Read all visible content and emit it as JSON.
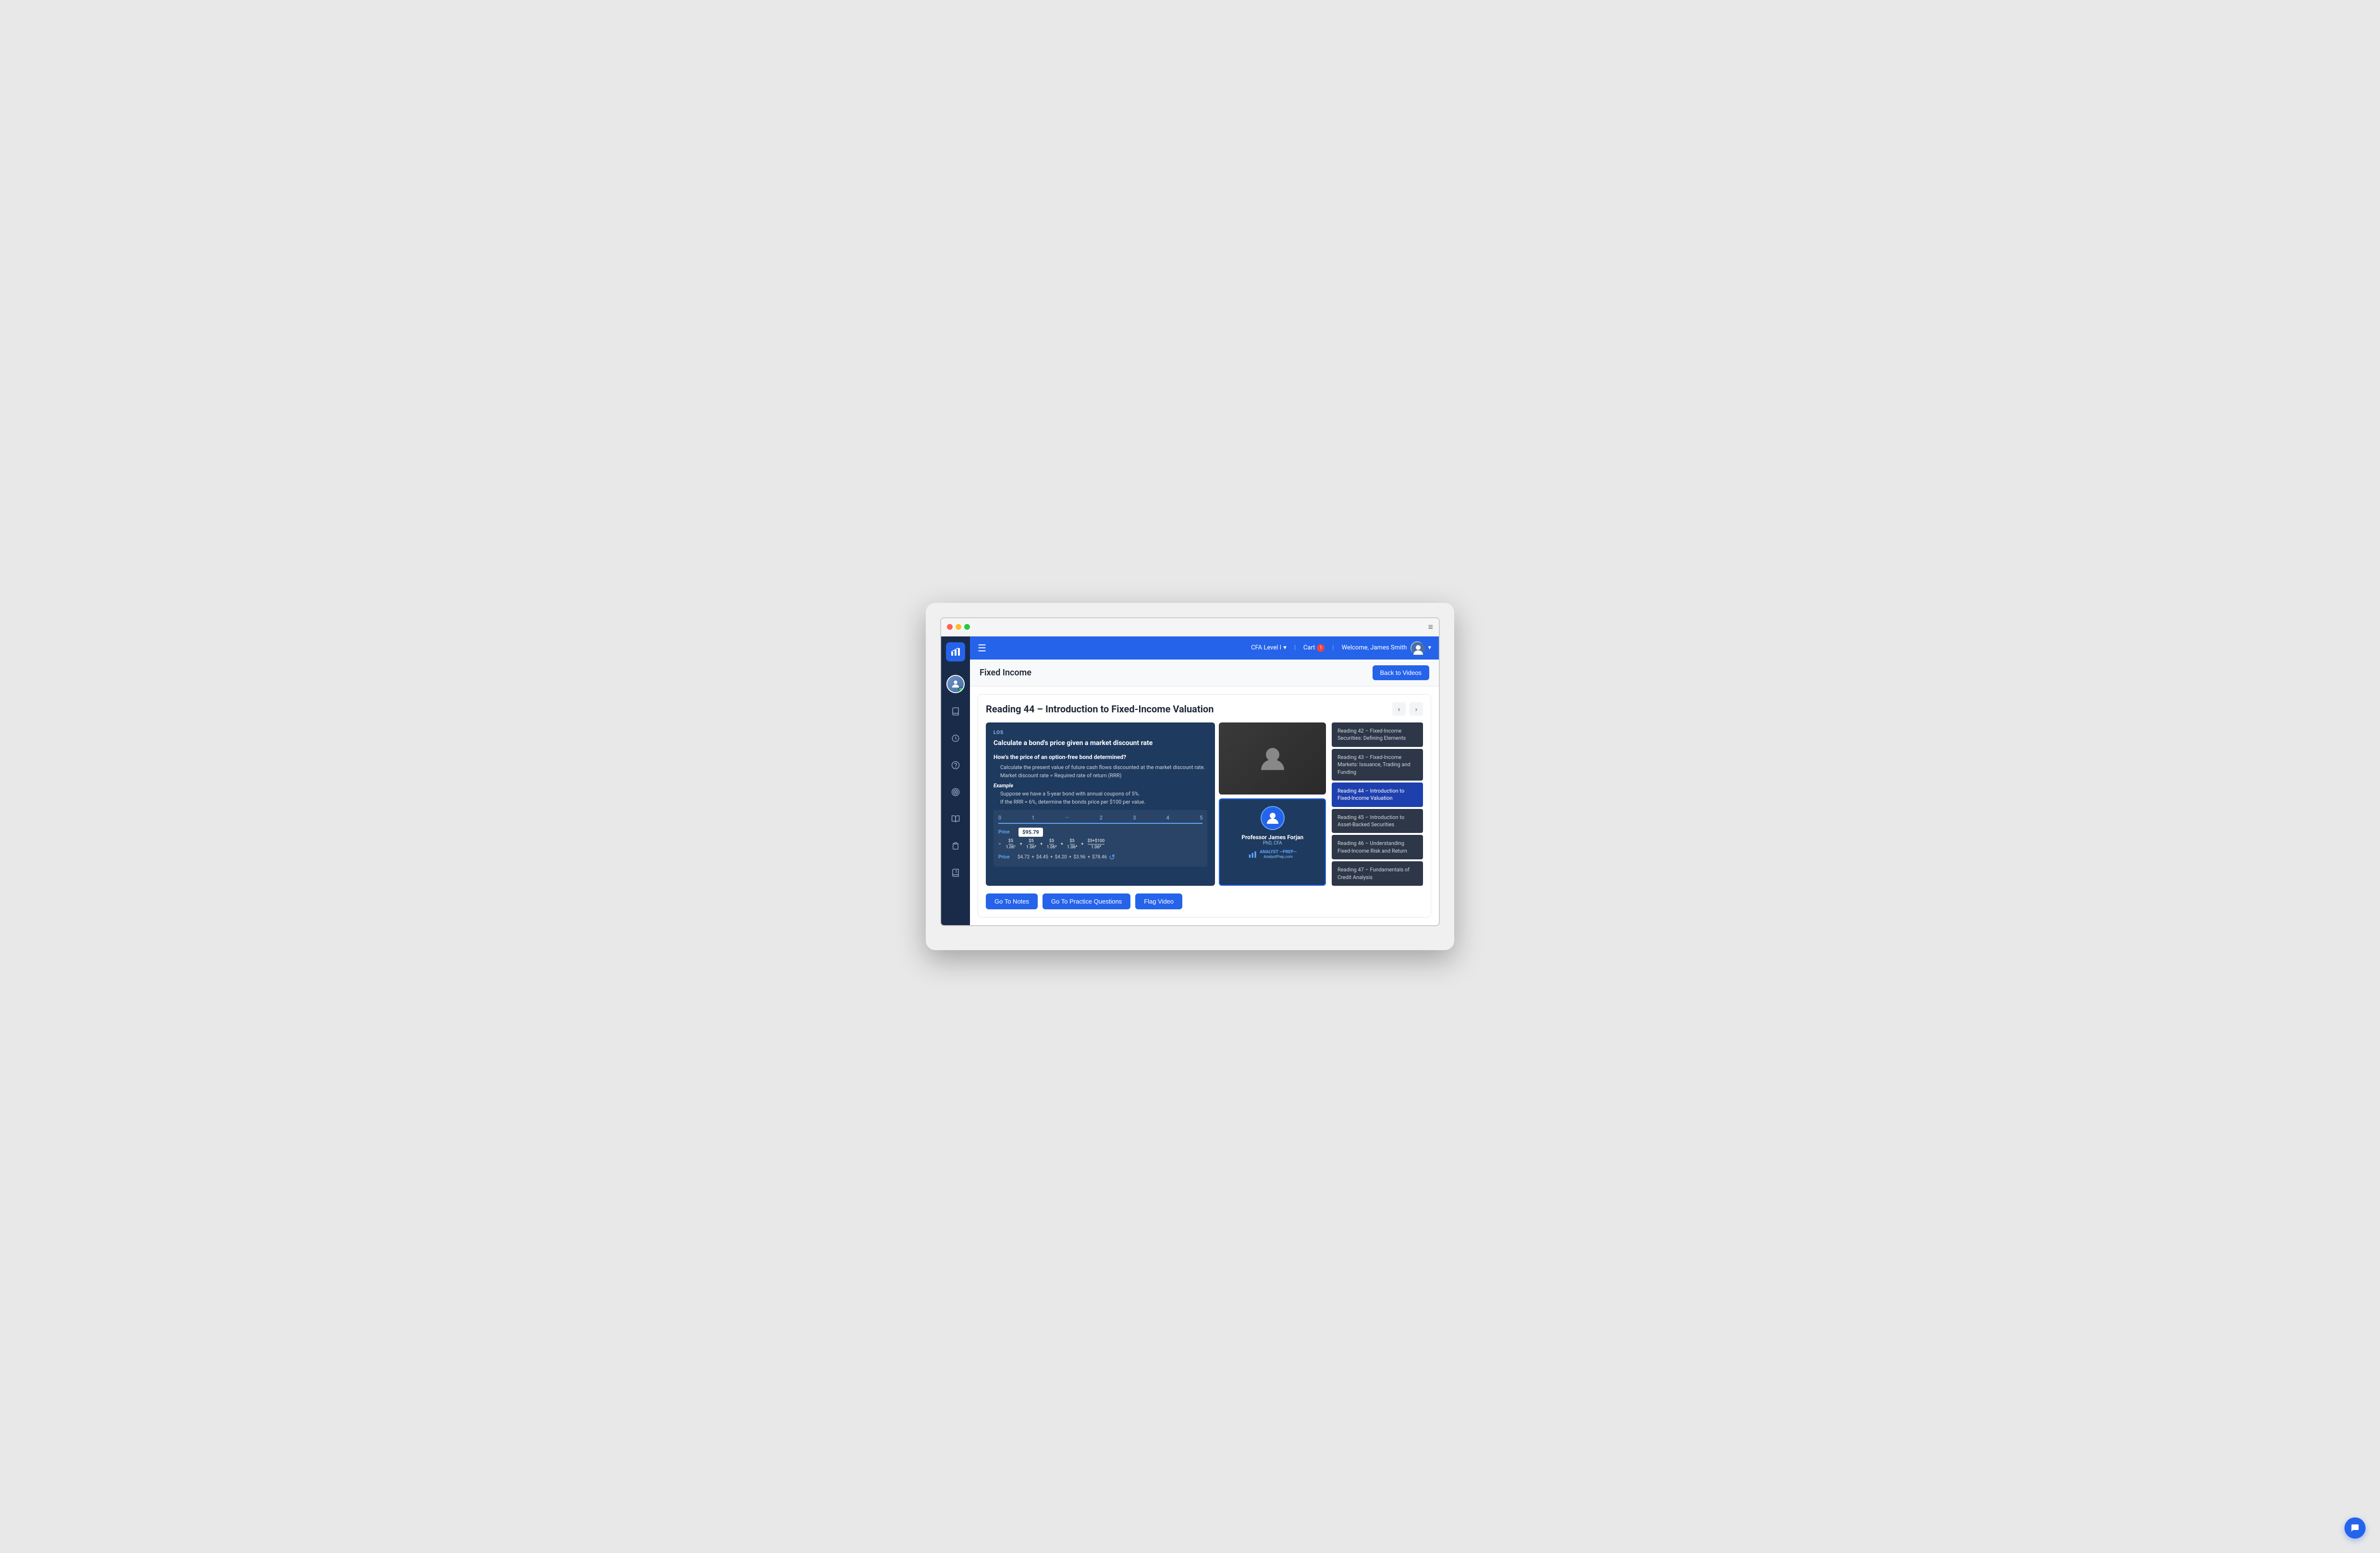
{
  "window": {
    "dots": [
      "red",
      "yellow",
      "green"
    ]
  },
  "topNav": {
    "hamburger": "☰",
    "level": "CFA Level I",
    "levelArrow": "▾",
    "cart": "Cart",
    "cartCount": "1",
    "welcome": "Welcome, James Smith",
    "userArrow": "▾"
  },
  "pageHeader": {
    "title": "Fixed Income",
    "backButton": "Back to Videos"
  },
  "reading": {
    "title": "Reading 44 – Introduction to Fixed-Income Valuation",
    "prevLabel": "‹",
    "nextLabel": "›"
  },
  "slide": {
    "los": "LOS",
    "heading": "Calculate a bond's price given a market discount rate",
    "subheading": "How's the price of an option-free bond determined?",
    "bullets": [
      "Calculate the present value of future cash flows discounted at the market discount rate.",
      "Market discount rate = Required rate of return (RRR)"
    ],
    "exampleLabel": "Example",
    "exampleBullets": [
      "Suppose we have a 5-year bond with annual coupons of 5%.",
      "If the RRR = 6%, determine the bonds price per $100 per value."
    ],
    "timeline": [
      "0",
      "1",
      "····",
      "2",
      "3",
      "4",
      "5"
    ],
    "priceLabel": "Price",
    "priceValue": "$95.79",
    "cashFlows": [
      "$5",
      "$5",
      "$5",
      "$5",
      "$5 + $100"
    ],
    "denominators": [
      "1.06¹",
      "1.06²",
      "1.06³",
      "1.06⁴",
      "1.06⁵"
    ],
    "values": [
      "$4.72",
      "+",
      "$4.45",
      "+",
      "$4.20",
      "+",
      "$3.96",
      "+",
      "$78.46"
    ]
  },
  "presenter": {
    "name": "Professor James Forjan",
    "title": "PhD, CFA",
    "logoText": "ANALYST\n—PREP—",
    "url": "AnalystPrep.com"
  },
  "readings": [
    {
      "id": "reading-42",
      "text": "Reading 42 – Fixed-Income Securities: Defining Elements"
    },
    {
      "id": "reading-43",
      "text": "Reading 43 – Fixed-Income Markets: Issuance, Trading and Funding"
    },
    {
      "id": "reading-44",
      "text": "Reading 44 – Introduction to Fixed-Income Valuation",
      "active": true
    },
    {
      "id": "reading-45",
      "text": "Reading 45 – Introduction to Asset-Backed Securities"
    },
    {
      "id": "reading-46",
      "text": "Reading 46 – Understanding Fixed-Income Risk and Return"
    },
    {
      "id": "reading-47",
      "text": "Reading 47 – Fundamentals of Credit Analysis"
    }
  ],
  "actionButtons": {
    "notes": "Go To Notes",
    "practice": "Go To Practice Questions",
    "flag": "Flag Video"
  },
  "sidebar": {
    "icons": [
      "📚",
      "🎓",
      "❓",
      "🎯",
      "📖",
      "📋",
      "📙"
    ]
  },
  "chat": {
    "icon": "💬"
  }
}
